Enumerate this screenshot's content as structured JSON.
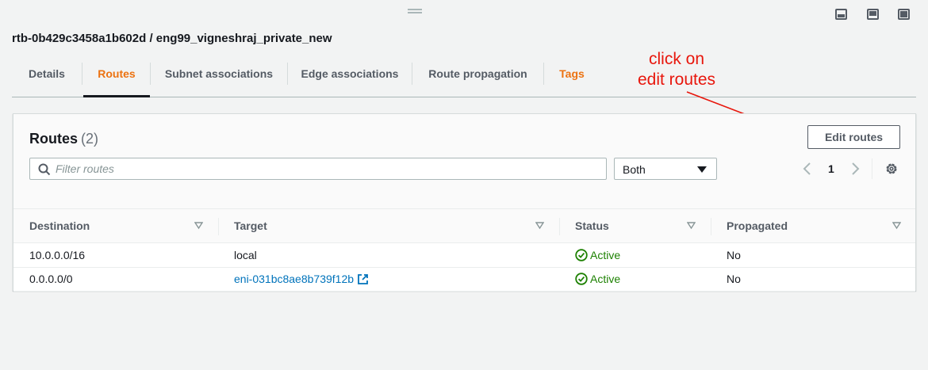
{
  "window": {
    "drag_handle": "drag-handle",
    "buttons": [
      "minimize-panel-icon",
      "split-panel-icon",
      "maximize-panel-icon"
    ]
  },
  "page_title": "rtb-0b429c3458a1b602d / eng99_vigneshraj_private_new",
  "tabs": [
    {
      "label": "Details"
    },
    {
      "label": "Routes"
    },
    {
      "label": "Subnet associations"
    },
    {
      "label": "Edge associations"
    },
    {
      "label": "Route propagation"
    },
    {
      "label": "Tags"
    }
  ],
  "active_tab": "Routes",
  "annotation": {
    "line1": "click on",
    "line2": "edit routes",
    "color": "#e8160c"
  },
  "routes_panel": {
    "title": "Routes",
    "count": "(2)",
    "edit_button": "Edit routes",
    "filter_placeholder": "Filter routes",
    "select_value": "Both",
    "page": "1",
    "columns": [
      "Destination",
      "Target",
      "Status",
      "Propagated"
    ],
    "rows": [
      {
        "destination": "10.0.0.0/16",
        "target": "local",
        "target_is_link": false,
        "status": "Active",
        "propagated": "No"
      },
      {
        "destination": "0.0.0.0/0",
        "target": "eni-031bc8ae8b739f12b",
        "target_is_link": true,
        "status": "Active",
        "propagated": "No"
      }
    ]
  },
  "colors": {
    "accent_orange": "#ec7211",
    "link_blue": "#0073bb",
    "success_green": "#1d8102",
    "background": "#f2f3f3"
  }
}
